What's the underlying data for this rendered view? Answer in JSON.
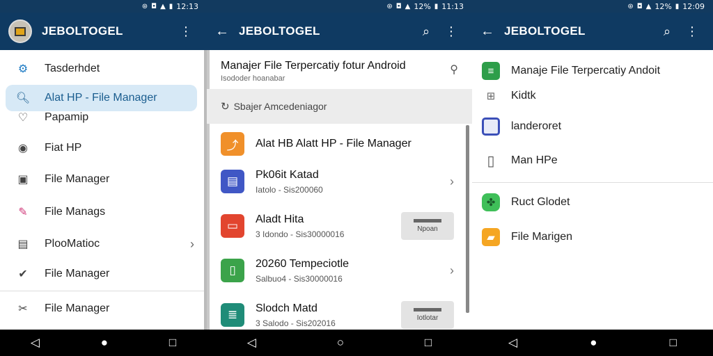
{
  "status": {
    "s1_time": "12:13",
    "s2_battery": "12%",
    "s2_time": "11:13",
    "s3_battery": "12%",
    "s3_time": "12:09"
  },
  "app": {
    "title": "JEBOLTOGEL"
  },
  "drawer": {
    "items": [
      {
        "label": "Tasderhdet",
        "icon": "gear-icon"
      },
      {
        "label": "Alat HP - File Manager",
        "icon": "search-icon"
      },
      {
        "label": "Papamip",
        "icon": "heart-icon"
      },
      {
        "label": "Fiat HP",
        "icon": "camera-icon"
      },
      {
        "label": "File Manager",
        "icon": "folder-icon"
      },
      {
        "label": "File Manags",
        "icon": "pen-icon"
      },
      {
        "label": "PlooMatioc",
        "icon": "clipboard-icon"
      },
      {
        "label": "File Manager",
        "icon": "check-icon"
      },
      {
        "label": "File Manager",
        "icon": "tools-icon"
      }
    ]
  },
  "s2": {
    "header_title": "Manajer File Terpercatiy fotur Android",
    "header_sub": "Isododer hoanabar",
    "search_placeholder": "Sbajer Amcedeniagor",
    "rows": [
      {
        "name": "Alat HB Alatt HP - File Manager",
        "meta": "",
        "icon": "share-icon",
        "color": "#f0902a"
      },
      {
        "name": "Pk06it Katad",
        "meta": "Iatolo - Sis200060",
        "icon": "document-icon",
        "color": "#4057c5"
      },
      {
        "name": "Aladt Hita",
        "meta": "3 Idondo - Sis30000016",
        "icon": "card-icon",
        "color": "#e2452f",
        "button": "Npoan"
      },
      {
        "name": "20260 Tempeciotle",
        "meta": "Salbuo4 - Sis30000016",
        "icon": "phone-icon",
        "color": "#3ba34a"
      },
      {
        "name": "Slodch Matd",
        "meta": "3 Salodo - Sis202016",
        "icon": "list-icon",
        "color": "#1f8c78",
        "button": "Iotlotar"
      }
    ]
  },
  "s3": {
    "items": [
      {
        "label": "Manaje File Terpercatiy Andoit",
        "icon": "sheet-icon",
        "color": "#2e9e4a"
      },
      {
        "label": "Kidtk",
        "icon": "file-tree-icon",
        "color": "#666666"
      },
      {
        "label": "landeroret",
        "icon": "square-icon",
        "color": "#3b4fb8"
      },
      {
        "label": "Man HPe",
        "icon": "tablet-icon",
        "color": "#555555"
      },
      {
        "label": "Ruct Glodet",
        "icon": "android-icon",
        "color": "#3fbf59"
      },
      {
        "label": "File Marigen",
        "icon": "folder-icon",
        "color": "#f5a623"
      }
    ]
  }
}
